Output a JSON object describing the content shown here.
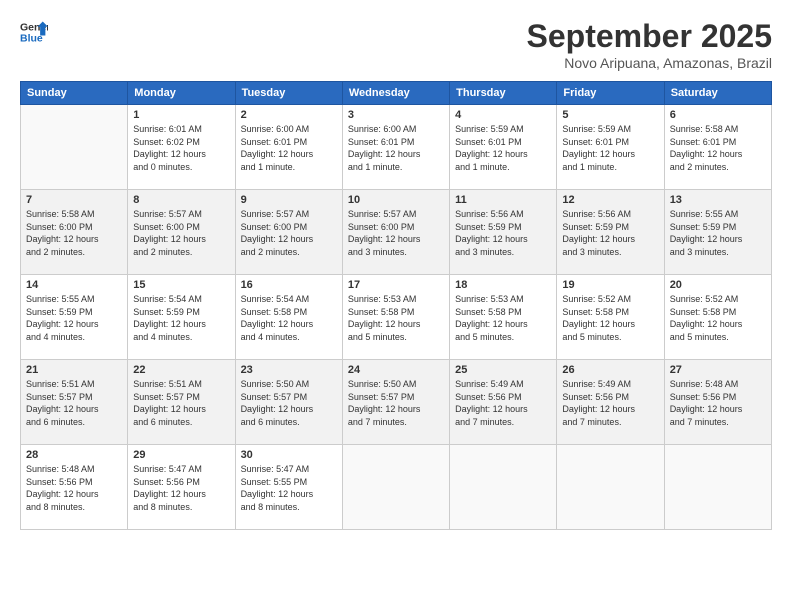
{
  "logo": {
    "line1": "General",
    "line2": "Blue"
  },
  "title": "September 2025",
  "subtitle": "Novo Aripuana, Amazonas, Brazil",
  "weekdays": [
    "Sunday",
    "Monday",
    "Tuesday",
    "Wednesday",
    "Thursday",
    "Friday",
    "Saturday"
  ],
  "weeks": [
    [
      {
        "day": "",
        "info": ""
      },
      {
        "day": "1",
        "info": "Sunrise: 6:01 AM\nSunset: 6:02 PM\nDaylight: 12 hours\nand 0 minutes."
      },
      {
        "day": "2",
        "info": "Sunrise: 6:00 AM\nSunset: 6:01 PM\nDaylight: 12 hours\nand 1 minute."
      },
      {
        "day": "3",
        "info": "Sunrise: 6:00 AM\nSunset: 6:01 PM\nDaylight: 12 hours\nand 1 minute."
      },
      {
        "day": "4",
        "info": "Sunrise: 5:59 AM\nSunset: 6:01 PM\nDaylight: 12 hours\nand 1 minute."
      },
      {
        "day": "5",
        "info": "Sunrise: 5:59 AM\nSunset: 6:01 PM\nDaylight: 12 hours\nand 1 minute."
      },
      {
        "day": "6",
        "info": "Sunrise: 5:58 AM\nSunset: 6:01 PM\nDaylight: 12 hours\nand 2 minutes."
      }
    ],
    [
      {
        "day": "7",
        "info": "Sunrise: 5:58 AM\nSunset: 6:00 PM\nDaylight: 12 hours\nand 2 minutes."
      },
      {
        "day": "8",
        "info": "Sunrise: 5:57 AM\nSunset: 6:00 PM\nDaylight: 12 hours\nand 2 minutes."
      },
      {
        "day": "9",
        "info": "Sunrise: 5:57 AM\nSunset: 6:00 PM\nDaylight: 12 hours\nand 2 minutes."
      },
      {
        "day": "10",
        "info": "Sunrise: 5:57 AM\nSunset: 6:00 PM\nDaylight: 12 hours\nand 3 minutes."
      },
      {
        "day": "11",
        "info": "Sunrise: 5:56 AM\nSunset: 5:59 PM\nDaylight: 12 hours\nand 3 minutes."
      },
      {
        "day": "12",
        "info": "Sunrise: 5:56 AM\nSunset: 5:59 PM\nDaylight: 12 hours\nand 3 minutes."
      },
      {
        "day": "13",
        "info": "Sunrise: 5:55 AM\nSunset: 5:59 PM\nDaylight: 12 hours\nand 3 minutes."
      }
    ],
    [
      {
        "day": "14",
        "info": "Sunrise: 5:55 AM\nSunset: 5:59 PM\nDaylight: 12 hours\nand 4 minutes."
      },
      {
        "day": "15",
        "info": "Sunrise: 5:54 AM\nSunset: 5:59 PM\nDaylight: 12 hours\nand 4 minutes."
      },
      {
        "day": "16",
        "info": "Sunrise: 5:54 AM\nSunset: 5:58 PM\nDaylight: 12 hours\nand 4 minutes."
      },
      {
        "day": "17",
        "info": "Sunrise: 5:53 AM\nSunset: 5:58 PM\nDaylight: 12 hours\nand 5 minutes."
      },
      {
        "day": "18",
        "info": "Sunrise: 5:53 AM\nSunset: 5:58 PM\nDaylight: 12 hours\nand 5 minutes."
      },
      {
        "day": "19",
        "info": "Sunrise: 5:52 AM\nSunset: 5:58 PM\nDaylight: 12 hours\nand 5 minutes."
      },
      {
        "day": "20",
        "info": "Sunrise: 5:52 AM\nSunset: 5:58 PM\nDaylight: 12 hours\nand 5 minutes."
      }
    ],
    [
      {
        "day": "21",
        "info": "Sunrise: 5:51 AM\nSunset: 5:57 PM\nDaylight: 12 hours\nand 6 minutes."
      },
      {
        "day": "22",
        "info": "Sunrise: 5:51 AM\nSunset: 5:57 PM\nDaylight: 12 hours\nand 6 minutes."
      },
      {
        "day": "23",
        "info": "Sunrise: 5:50 AM\nSunset: 5:57 PM\nDaylight: 12 hours\nand 6 minutes."
      },
      {
        "day": "24",
        "info": "Sunrise: 5:50 AM\nSunset: 5:57 PM\nDaylight: 12 hours\nand 7 minutes."
      },
      {
        "day": "25",
        "info": "Sunrise: 5:49 AM\nSunset: 5:56 PM\nDaylight: 12 hours\nand 7 minutes."
      },
      {
        "day": "26",
        "info": "Sunrise: 5:49 AM\nSunset: 5:56 PM\nDaylight: 12 hours\nand 7 minutes."
      },
      {
        "day": "27",
        "info": "Sunrise: 5:48 AM\nSunset: 5:56 PM\nDaylight: 12 hours\nand 7 minutes."
      }
    ],
    [
      {
        "day": "28",
        "info": "Sunrise: 5:48 AM\nSunset: 5:56 PM\nDaylight: 12 hours\nand 8 minutes."
      },
      {
        "day": "29",
        "info": "Sunrise: 5:47 AM\nSunset: 5:56 PM\nDaylight: 12 hours\nand 8 minutes."
      },
      {
        "day": "30",
        "info": "Sunrise: 5:47 AM\nSunset: 5:55 PM\nDaylight: 12 hours\nand 8 minutes."
      },
      {
        "day": "",
        "info": ""
      },
      {
        "day": "",
        "info": ""
      },
      {
        "day": "",
        "info": ""
      },
      {
        "day": "",
        "info": ""
      }
    ]
  ]
}
